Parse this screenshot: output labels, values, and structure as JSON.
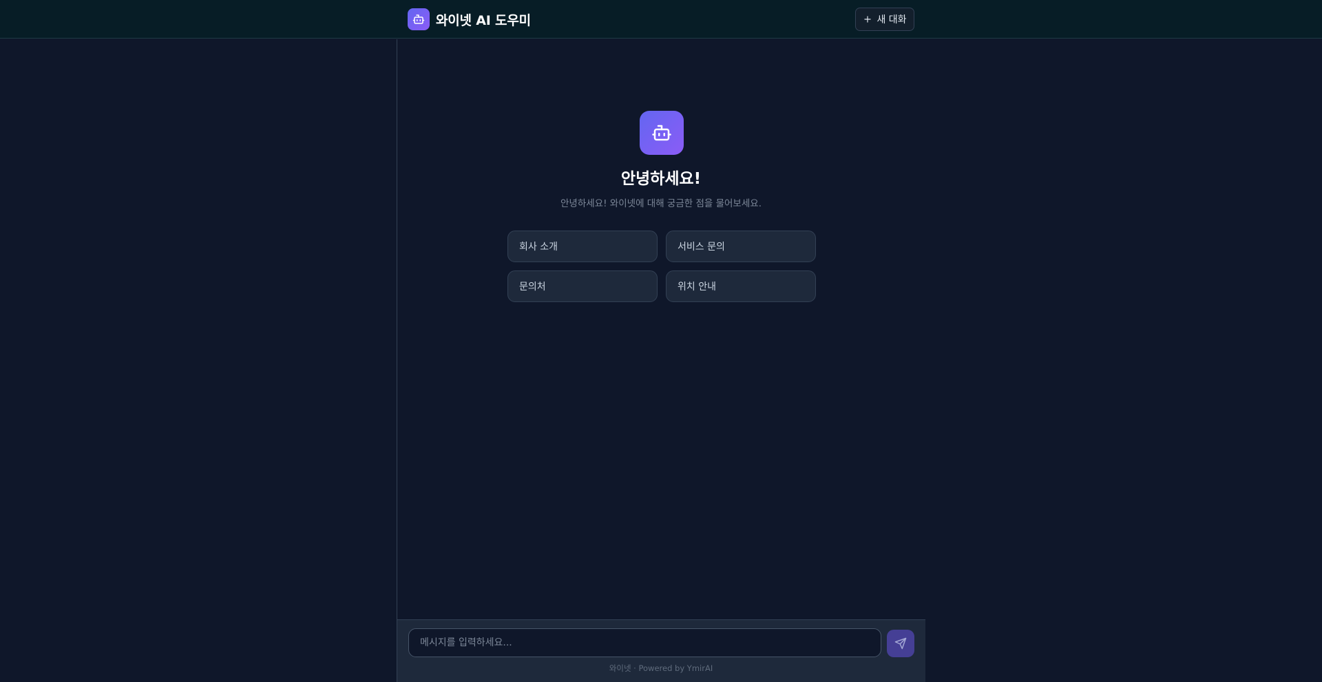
{
  "header": {
    "logo_icon": "robot-icon",
    "title": "와이넷 AI 도우미",
    "new_chat_icon": "plus-icon",
    "new_chat_label": "새 대화"
  },
  "welcome": {
    "icon": "robot-icon",
    "title": "안녕하세요!",
    "subtitle": "안녕하세요! 와이넷에 대해 궁금한 점을 물어보세요."
  },
  "quick_questions": [
    "회사 소개",
    "서비스 문의",
    "문의처",
    "위치 안내"
  ],
  "composer": {
    "placeholder": "메시지를 입력하세요...",
    "value": "",
    "send_icon": "send-icon"
  },
  "footer": {
    "text": "와이넷 · Powered by YmirAI"
  },
  "colors": {
    "accent": "#6366f1",
    "accent_secondary": "#8b5cf6",
    "background": "#0f172a",
    "header_bg": "#071d26",
    "panel_bg": "#1e293b"
  }
}
